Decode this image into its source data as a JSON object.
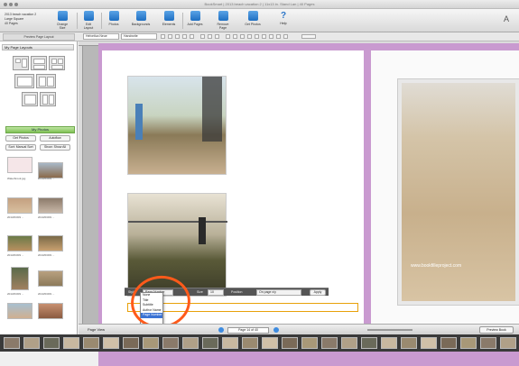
{
  "window": {
    "title": "BookSmart | 2013 beach vacation 2 | 11x13 in. Stand Lan | 40 Pages"
  },
  "project": {
    "line1": "2013 beach vacation 2",
    "line2": "Large Square",
    "line3": "40 Pages"
  },
  "toolbar": {
    "items": [
      {
        "label": "Change Size"
      },
      {
        "label": "Edit Layout"
      },
      {
        "label": "Photos"
      },
      {
        "label": "Backgrounds"
      },
      {
        "label": "Elements"
      },
      {
        "label": "Add Pages"
      },
      {
        "label": "Remove Page"
      },
      {
        "label": "Get Photos"
      }
    ],
    "help_label": "Help",
    "help_glyph": "?"
  },
  "statusbar": {
    "panel_label": "Preview Page Layout",
    "font_family": "Helvetica Neue",
    "font_style": "Handwrite"
  },
  "sidebar": {
    "layouts_title": "My Page Layouts",
    "photos_title": "My Photos",
    "get_photos": "Get Photos",
    "auto_flow": "Autoflow",
    "sort_label": "Sort: Manual Sort",
    "show_label": "Show: Show All",
    "captions": [
      "Waterbrook.jpg",
      "2013/03/09 ...",
      "2013/03/09 ...",
      "2013/03/09 ...",
      "2013/03/09 ...",
      "2013/03/09 ...",
      "2013/03/09 ...",
      "2013/03/09 ..."
    ]
  },
  "format_bar": {
    "style_label": "Style:",
    "style_value": "Page Number",
    "size_label": "Size",
    "size_value": "10",
    "align_label": "Position",
    "align_value": "On page x/y",
    "apply_label": "Apply"
  },
  "dropdown": {
    "options": [
      "None",
      "Title",
      "Subtitle",
      "Author Name",
      "Page Number"
    ],
    "selected_index": 4
  },
  "watermark": "www.bookfilleproject.com",
  "pagebar": {
    "view_label": "Page View",
    "page_value": "Page 14 of 40",
    "preview_label": "Preview Book"
  },
  "colors": {
    "accent": "#3a72d4",
    "spread_bg": "#c99ad0",
    "annotation": "#ff5a1a",
    "textbox": "#e8a10a"
  }
}
